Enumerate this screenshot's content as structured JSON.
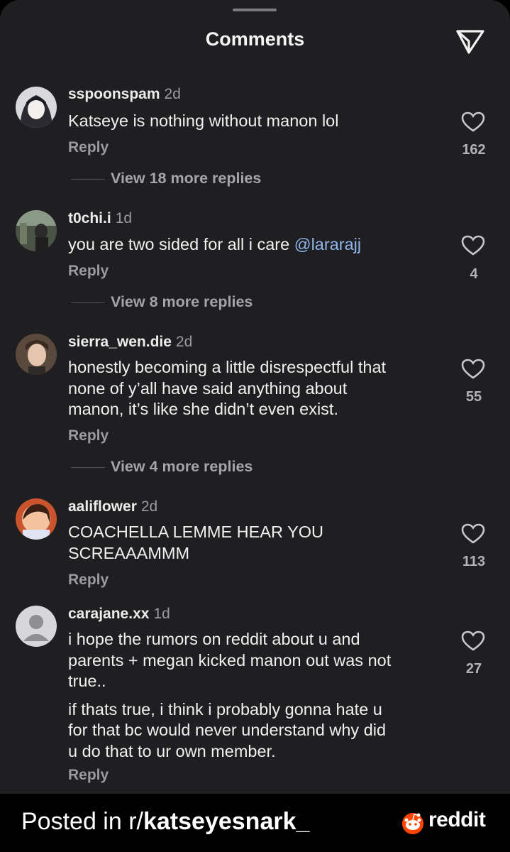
{
  "header": {
    "title": "Comments",
    "share_icon": "paper-plane-icon"
  },
  "comments": [
    {
      "username": "sspoonspam",
      "time": "2d",
      "lines": [
        "Katseye is nothing without manon lol"
      ],
      "reply_label": "Reply",
      "likes": "162",
      "view_replies": "View 18 more replies"
    },
    {
      "username": "t0chi.i",
      "time": "1d",
      "text": "you are two sided for all i care ",
      "mention": "@lararajj",
      "reply_label": "Reply",
      "likes": "4",
      "view_replies": "View 8 more replies"
    },
    {
      "username": "sierra_wen.die",
      "time": "2d",
      "lines": [
        "honestly becoming a little disrespectful that",
        "none of y’all have said anything about",
        "manon, it’s like she didn’t even exist."
      ],
      "reply_label": "Reply",
      "likes": "55",
      "view_replies": "View 4 more replies"
    },
    {
      "username": "aaliflower",
      "time": "2d",
      "lines": [
        "COACHELLA LEMME HEAR YOU",
        "SCREAAAMMM"
      ],
      "reply_label": "Reply",
      "likes": "113"
    },
    {
      "username": "carajane.xx",
      "time": "1d",
      "lines": [
        "i hope the rumors on reddit about u and",
        "parents + megan kicked manon out was not",
        "true.."
      ],
      "lines2": [
        "if thats true, i think i probably gonna hate u",
        "for that bc would never understand why did",
        "u do that to ur own member."
      ],
      "reply_label": "Reply",
      "likes": "27"
    }
  ],
  "footer": {
    "posted_prefix": "Posted in r/",
    "subreddit": "katseyesnark_",
    "brand": "reddit",
    "brand_icon": "reddit-snoo-icon"
  },
  "colors": {
    "background": "#1f1f21",
    "mention": "#8fb4ea",
    "muted": "#9a9aa0"
  }
}
